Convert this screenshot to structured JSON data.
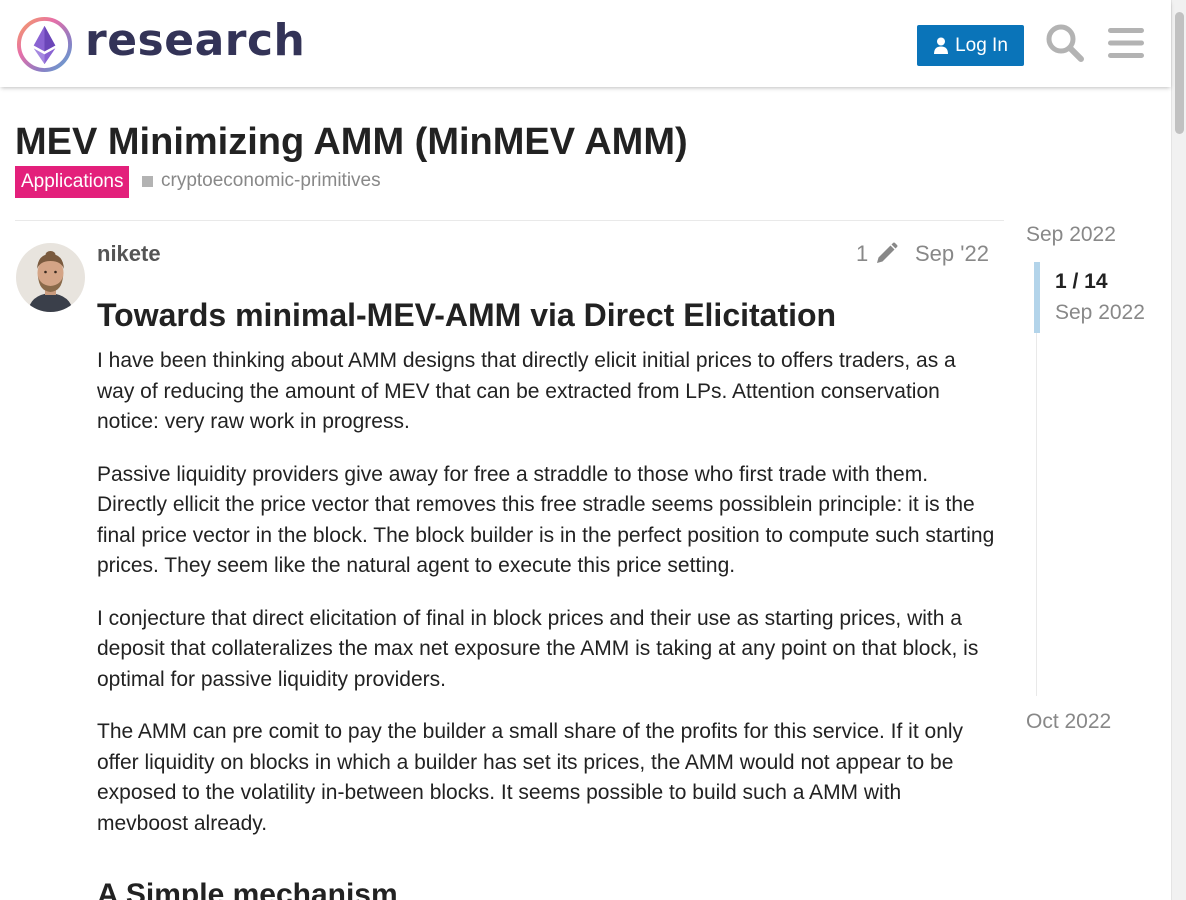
{
  "header": {
    "logo_text": "research",
    "login_label": "Log In",
    "search_icon": "search-icon",
    "menu_icon": "hamburger-menu-icon",
    "accent_color": "#0a74b9"
  },
  "topic": {
    "title": "MEV Minimizing AMM (MinMEV AMM)",
    "category": "Applications",
    "category_color": "#e3207b",
    "tag": "cryptoeconomic-primitives"
  },
  "post": {
    "username": "nikete",
    "edit_count": "1",
    "date": "Sep '22",
    "heading": "Towards minimal-MEV-AMM via Direct Elicitation",
    "paragraphs": [
      "I have been thinking about AMM designs that directly elicit initial prices to offers traders, as a way of reducing the amount of MEV that can be extracted from LPs. Attention conservation notice: very raw work in progress.",
      "Passive liquidity providers give away for free a straddle to those who first trade with them. Directly ellicit the price vector that removes this free stradle seems possiblein principle: it is the final price vector in the block. The block builder is in the perfect position to compute such starting prices. They seem like the natural agent to execute this price setting.",
      "I conjecture that direct elicitation of final in block prices and their use as starting prices, with a deposit that collateralizes the max net exposure the AMM is taking at any point on that block, is optimal for passive liquidity providers.",
      "The AMM can pre comit to pay the builder a small share of the profits for this service. If it only offer liquidity on blocks in which a builder has set its prices, the AMM would not appear to be exposed to the volatility in-between blocks. It seems possible to build such a AMM with mevboost already."
    ],
    "subheading": "A Simple mechanism"
  },
  "timeline": {
    "start_date": "Sep 2022",
    "position": "1 / 14",
    "position_date": "Sep 2022",
    "end_date": "Oct 2022"
  }
}
